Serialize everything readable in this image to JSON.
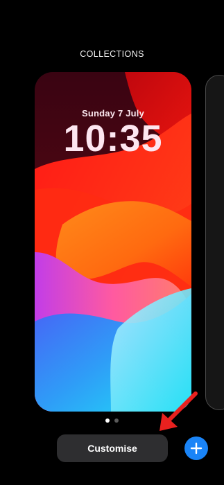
{
  "header": {
    "title": "COLLECTIONS"
  },
  "lock_screen": {
    "date": "Sunday 7 July",
    "time": "10:35"
  },
  "pagination": {
    "total": 2,
    "current": 1
  },
  "actions": {
    "customise_label": "Customise",
    "add_icon": "plus-icon"
  },
  "colors": {
    "accent_blue": "#1a84f7",
    "button_bg": "#2e2e30",
    "annotation_red": "#e8211f"
  }
}
